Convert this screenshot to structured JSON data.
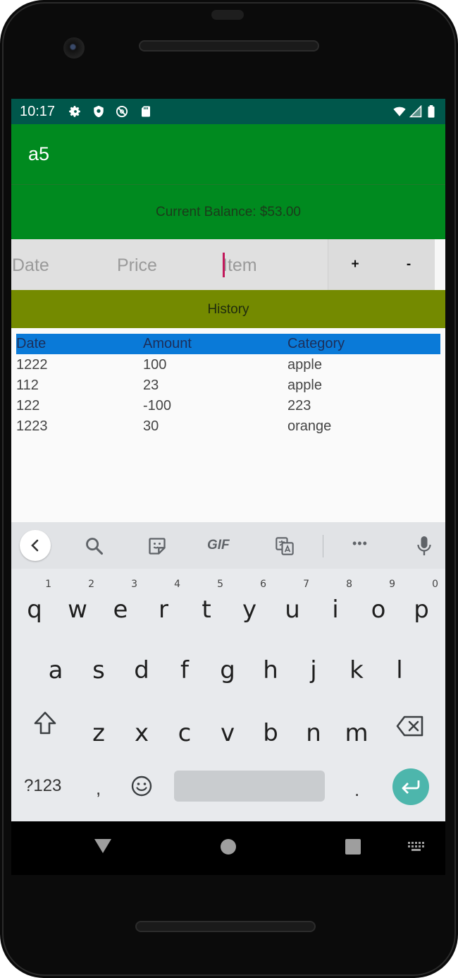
{
  "status_bar": {
    "time": "10:17",
    "left_icons": [
      "gear-icon",
      "shield-icon",
      "blocked-icon",
      "sd-card-icon"
    ],
    "right_icons": [
      "wifi-icon",
      "signal-icon",
      "battery-icon"
    ]
  },
  "app": {
    "title": "a5",
    "balance_label": "Current Balance: $53.00"
  },
  "input_row": {
    "date_placeholder": "Date",
    "price_placeholder": "Price",
    "item_placeholder": "Item",
    "plus_label": "+",
    "minus_label": "-"
  },
  "history": {
    "title": "History",
    "columns": [
      "Date",
      "Amount",
      "Category"
    ],
    "rows": [
      [
        "1222",
        "100",
        "apple"
      ],
      [
        "112",
        "23",
        "apple"
      ],
      [
        "122",
        "-100",
        "223"
      ],
      [
        "1223",
        "30",
        "orange"
      ]
    ]
  },
  "keyboard": {
    "toolbar": [
      "back-chevron-icon",
      "search-icon",
      "sticker-icon",
      "gif-icon",
      "translate-icon",
      "more-icon",
      "mic-icon"
    ],
    "gif_label": "GIF",
    "more_label": "•••",
    "row1": [
      "q",
      "w",
      "e",
      "r",
      "t",
      "y",
      "u",
      "i",
      "o",
      "p"
    ],
    "row1_hints": [
      "1",
      "2",
      "3",
      "4",
      "5",
      "6",
      "7",
      "8",
      "9",
      "0"
    ],
    "row2": [
      "a",
      "s",
      "d",
      "f",
      "g",
      "h",
      "j",
      "k",
      "l"
    ],
    "row3": [
      "z",
      "x",
      "c",
      "v",
      "b",
      "n",
      "m"
    ],
    "symbols_label": "?123",
    "comma_label": ",",
    "period_label": ".",
    "accent_color": "#4db6ac"
  },
  "colors": {
    "status_bar": "#00574b",
    "app_bar": "#008a1f",
    "history_bar": "#748a00",
    "table_header": "#0a7ad8"
  }
}
